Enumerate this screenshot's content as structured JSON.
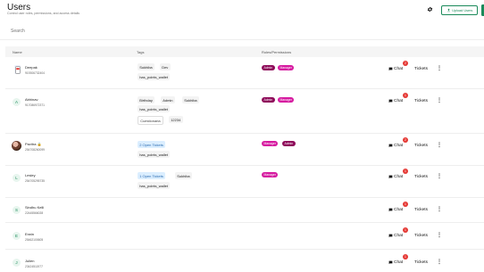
{
  "header": {
    "title": "Users",
    "subtitle": "Control user roles, permissions, and access details",
    "upload_label": "Upload Users",
    "settings_icon": "gear-icon",
    "upload_icon": "upload-icon"
  },
  "search": {
    "placeholder": "Search"
  },
  "table": {
    "columns": {
      "name": "Name",
      "tags": "Tags",
      "roles": "Roles/Permissions"
    },
    "chat_label": "Chat",
    "tickets_label": "Tickets",
    "rows": [
      {
        "name": "Deepak",
        "phone": "919306732404",
        "avatar": "phone",
        "badge": "2",
        "tags": [
          "Sukhiba",
          "Dev",
          "has_points_wallet"
        ],
        "roles": [
          "Admin",
          "Manager"
        ]
      },
      {
        "name": "Abhinav",
        "phone": "917086972371",
        "avatar": "A",
        "badge": "1",
        "tags": [
          "Birthday",
          "Admin",
          "Sukhiba",
          "has_points_wallet",
          "Cuestionaria",
          "12234"
        ],
        "roles": [
          "Admin",
          "Manager"
        ]
      },
      {
        "name": "Pavitra 🔒",
        "phone": "254708260099",
        "avatar": "photo",
        "badge": "2",
        "tags": [
          "2 Open Tickets",
          "has_points_wallet"
        ],
        "roles": [
          "Manager",
          "Admin"
        ]
      },
      {
        "name": "Lesley",
        "phone": "254705295735",
        "avatar": "L",
        "badge": "1",
        "tags": [
          "1 Open Tickets",
          "Sukhiba",
          "has_points_wallet"
        ],
        "roles": [
          "Manager"
        ]
      },
      {
        "name": "Sindhu Kelli",
        "phone": "22445566028",
        "avatar": "S",
        "badge": "1",
        "tags": [],
        "roles": []
      },
      {
        "name": "Erwin",
        "phone": "25462100605",
        "avatar": "E",
        "badge": "1",
        "tags": [],
        "roles": []
      },
      {
        "name": "Julien",
        "phone": "23424511977",
        "avatar": "J",
        "badge": "1",
        "tags": [],
        "roles": []
      }
    ]
  },
  "colors": {
    "accent": "#1b8a5a",
    "admin": "#8e0b5a",
    "manager": "#d61aa0",
    "badge": "#e53935"
  }
}
